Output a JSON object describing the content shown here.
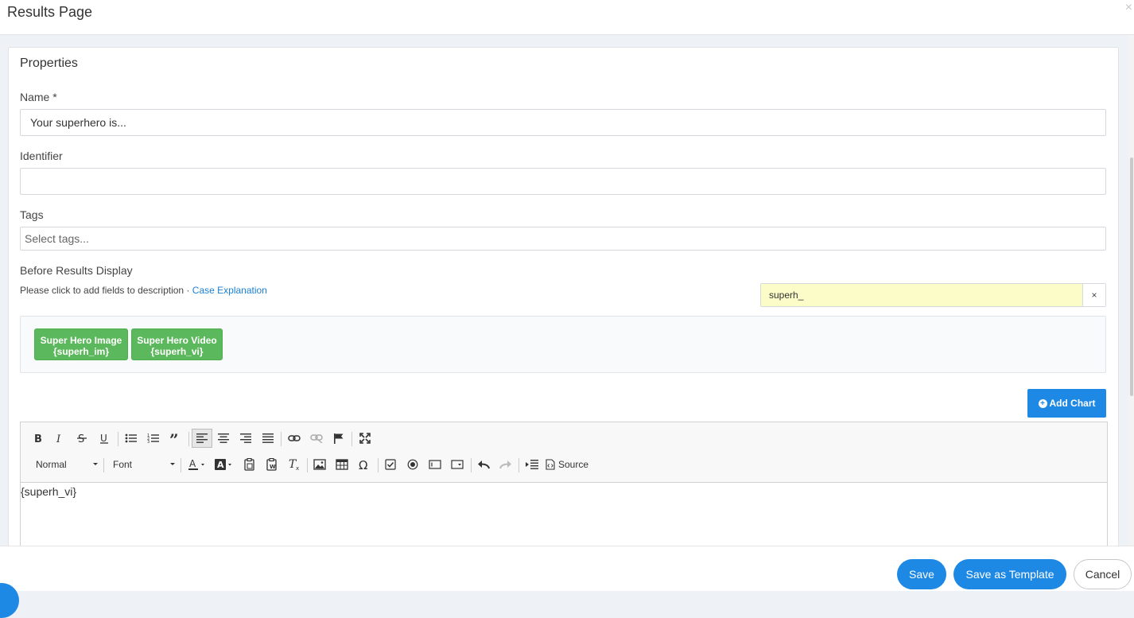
{
  "header": {
    "title": "Results Page",
    "close_icon": "×"
  },
  "properties": {
    "title": "Properties",
    "name": {
      "label": "Name *",
      "value": "Your superhero is..."
    },
    "identifier": {
      "label": "Identifier",
      "value": ""
    },
    "tags": {
      "label": "Tags",
      "placeholder": "Select tags..."
    },
    "before_results": {
      "label": "Before Results Display",
      "hint": "Please click to add fields to description",
      "hint_separator": "·",
      "hint_link": "Case Explanation",
      "field_search": {
        "value": "superh_",
        "clear": "×"
      },
      "field_buttons": [
        {
          "line1": "Super Hero Image",
          "line2": "{superh_im}"
        },
        {
          "line1": "Super Hero Video",
          "line2": "{superh_vi}"
        }
      ]
    },
    "add_chart": "Add Chart"
  },
  "editor": {
    "format_select": "Normal",
    "font_select": "Font",
    "source_label": "Source",
    "content": "{superh_vi}"
  },
  "footer": {
    "save": "Save",
    "save_template": "Save as Template",
    "cancel": "Cancel"
  },
  "colors": {
    "accent": "#1e88e5",
    "field_button": "#5cb85c",
    "search_highlight": "#fbfcc8",
    "link": "#1a7fd4"
  }
}
